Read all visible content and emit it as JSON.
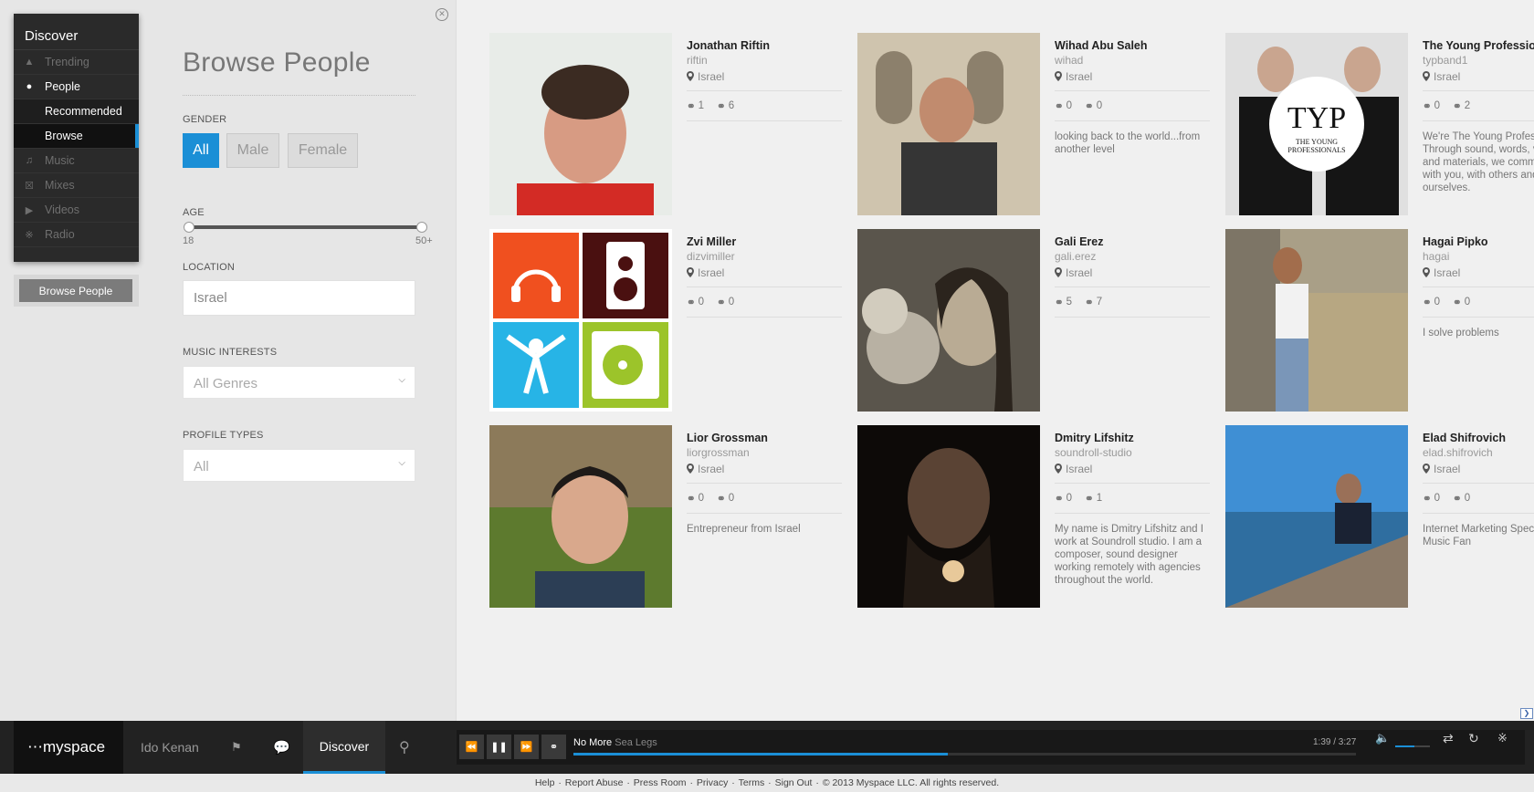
{
  "sidebar": {
    "title": "Discover",
    "items": [
      {
        "label": "Trending",
        "icon": "flame-icon"
      },
      {
        "label": "People",
        "icon": "people-icon"
      },
      {
        "label": "Recommended"
      },
      {
        "label": "Browse"
      },
      {
        "label": "Music",
        "icon": "music-note-icon"
      },
      {
        "label": "Mixes",
        "icon": "mix-icon"
      },
      {
        "label": "Videos",
        "icon": "video-icon"
      },
      {
        "label": "Radio",
        "icon": "radio-icon"
      }
    ],
    "browse_button": "Browse People"
  },
  "filters": {
    "title": "Browse People",
    "gender_label": "GENDER",
    "gender_options": [
      "All",
      "Male",
      "Female"
    ],
    "gender_selected": "All",
    "age_label": "AGE",
    "age_min": "18",
    "age_max": "50+",
    "location_label": "LOCATION",
    "location_value": "Israel",
    "music_label": "MUSIC INTERESTS",
    "music_value": "All Genres",
    "profile_label": "PROFILE TYPES",
    "profile_value": "All"
  },
  "people": [
    {
      "name": "Jonathan Riftin",
      "username": "riftin",
      "location": "Israel",
      "connections": "1",
      "connected_to": "6",
      "bio": ""
    },
    {
      "name": "Wihad Abu Saleh",
      "username": "wihad",
      "location": "Israel",
      "connections": "0",
      "connected_to": "0",
      "bio": "looking back to the world...from another level"
    },
    {
      "name": "The Young Professionals",
      "username": "typband1",
      "location": "Israel",
      "connections": "0",
      "connected_to": "2",
      "bio": "We're The Young Professionals. Through sound, words, visuals and materials, we communicate with you, with others and with ourselves."
    },
    {
      "name": "Zvi Miller",
      "username": "dizvimiller",
      "location": "Israel",
      "connections": "0",
      "connected_to": "0",
      "bio": ""
    },
    {
      "name": "Gali Erez",
      "username": "gali.erez",
      "location": "Israel",
      "connections": "5",
      "connected_to": "7",
      "bio": ""
    },
    {
      "name": "Hagai Pipko",
      "username": "hagai",
      "location": "Israel",
      "connections": "0",
      "connected_to": "0",
      "bio": "I solve problems"
    },
    {
      "name": "Lior Grossman",
      "username": "liorgrossman",
      "location": "Israel",
      "connections": "0",
      "connected_to": "0",
      "bio": "Entrepreneur from Israel"
    },
    {
      "name": "Dmitry Lifshitz",
      "username": "soundroll-studio",
      "location": "Israel",
      "connections": "0",
      "connected_to": "1",
      "bio": "My name is Dmitry Lifshitz and I work at Soundroll studio. I am a composer, sound designer working remotely with agencies throughout the world."
    },
    {
      "name": "Elad Shifrovich",
      "username": "elad.shifrovich",
      "location": "Israel",
      "connections": "0",
      "connected_to": "0",
      "bio": "Internet Marketing Specialist, Big Music Fan"
    }
  ],
  "player": {
    "logo": "myspace",
    "user": "Ido Kenan",
    "discover": "Discover",
    "track": "No More",
    "artist": "Sea Legs",
    "time": "1:39 / 3:27",
    "progress": 0.478,
    "volume": 0.55
  },
  "footer": {
    "links": [
      "Help",
      "Report Abuse",
      "Press Room",
      "Privacy",
      "Terms",
      "Sign Out"
    ],
    "copyright": "© 2013 Myspace LLC. All rights reserved."
  },
  "colors": {
    "accent": "#1b8fd6",
    "dark": "#222222"
  }
}
